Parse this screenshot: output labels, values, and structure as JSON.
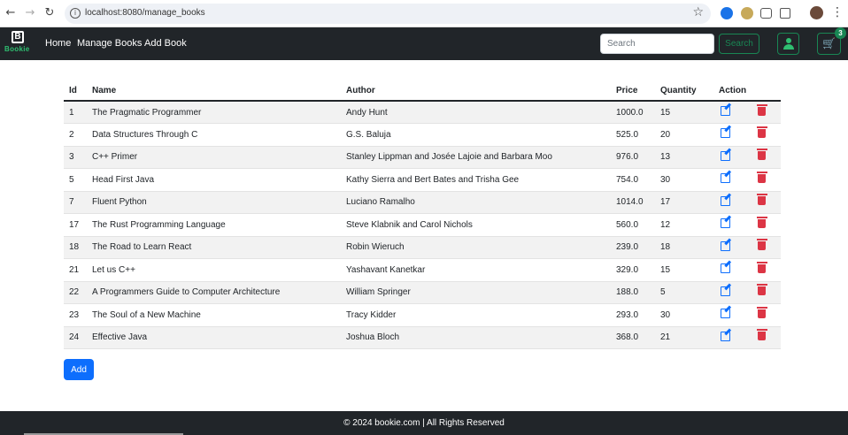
{
  "browser": {
    "url": "localhost:8080/manage_books"
  },
  "navbar": {
    "brand_letter": "B",
    "brand_name": "Bookie",
    "links": [
      "Home",
      "Manage Books",
      "Add Book"
    ],
    "search_placeholder": "Search",
    "search_button": "Search",
    "cart_count": "3"
  },
  "table": {
    "headers": [
      "Id",
      "Name",
      "Author",
      "Price",
      "Quantity",
      "Action"
    ],
    "rows": [
      {
        "id": "1",
        "name": "The Pragmatic Programmer",
        "author": "Andy Hunt",
        "price": "1000.0",
        "quantity": "15"
      },
      {
        "id": "2",
        "name": "Data Structures Through C",
        "author": "G.S. Baluja",
        "price": "525.0",
        "quantity": "20"
      },
      {
        "id": "3",
        "name": "C++ Primer",
        "author": "Stanley Lippman and Josée Lajoie and Barbara Moo",
        "price": "976.0",
        "quantity": "13"
      },
      {
        "id": "5",
        "name": "Head First Java",
        "author": "Kathy Sierra and Bert Bates and Trisha Gee",
        "price": "754.0",
        "quantity": "30"
      },
      {
        "id": "7",
        "name": "Fluent Python",
        "author": "Luciano Ramalho",
        "price": "1014.0",
        "quantity": "17"
      },
      {
        "id": "17",
        "name": "The Rust Programming Language",
        "author": "Steve Klabnik and Carol Nichols",
        "price": "560.0",
        "quantity": "12"
      },
      {
        "id": "18",
        "name": "The Road to Learn React",
        "author": "Robin Wieruch",
        "price": "239.0",
        "quantity": "18"
      },
      {
        "id": "21",
        "name": "Let us C++",
        "author": "Yashavant Kanetkar",
        "price": "329.0",
        "quantity": "15"
      },
      {
        "id": "22",
        "name": "A Programmers Guide to Computer Architecture",
        "author": "William Springer",
        "price": "188.0",
        "quantity": "5"
      },
      {
        "id": "23",
        "name": "The Soul of a New Machine",
        "author": "Tracy Kidder",
        "price": "293.0",
        "quantity": "30"
      },
      {
        "id": "24",
        "name": "Effective Java",
        "author": "Joshua Bloch",
        "price": "368.0",
        "quantity": "21"
      }
    ]
  },
  "add_button": "Add",
  "footer": "© 2024 bookie.com | All Rights Reserved",
  "colors": {
    "navbar_bg": "#212529",
    "accent_green": "#198754",
    "primary_blue": "#0d6efd",
    "danger_red": "#dc3545"
  }
}
